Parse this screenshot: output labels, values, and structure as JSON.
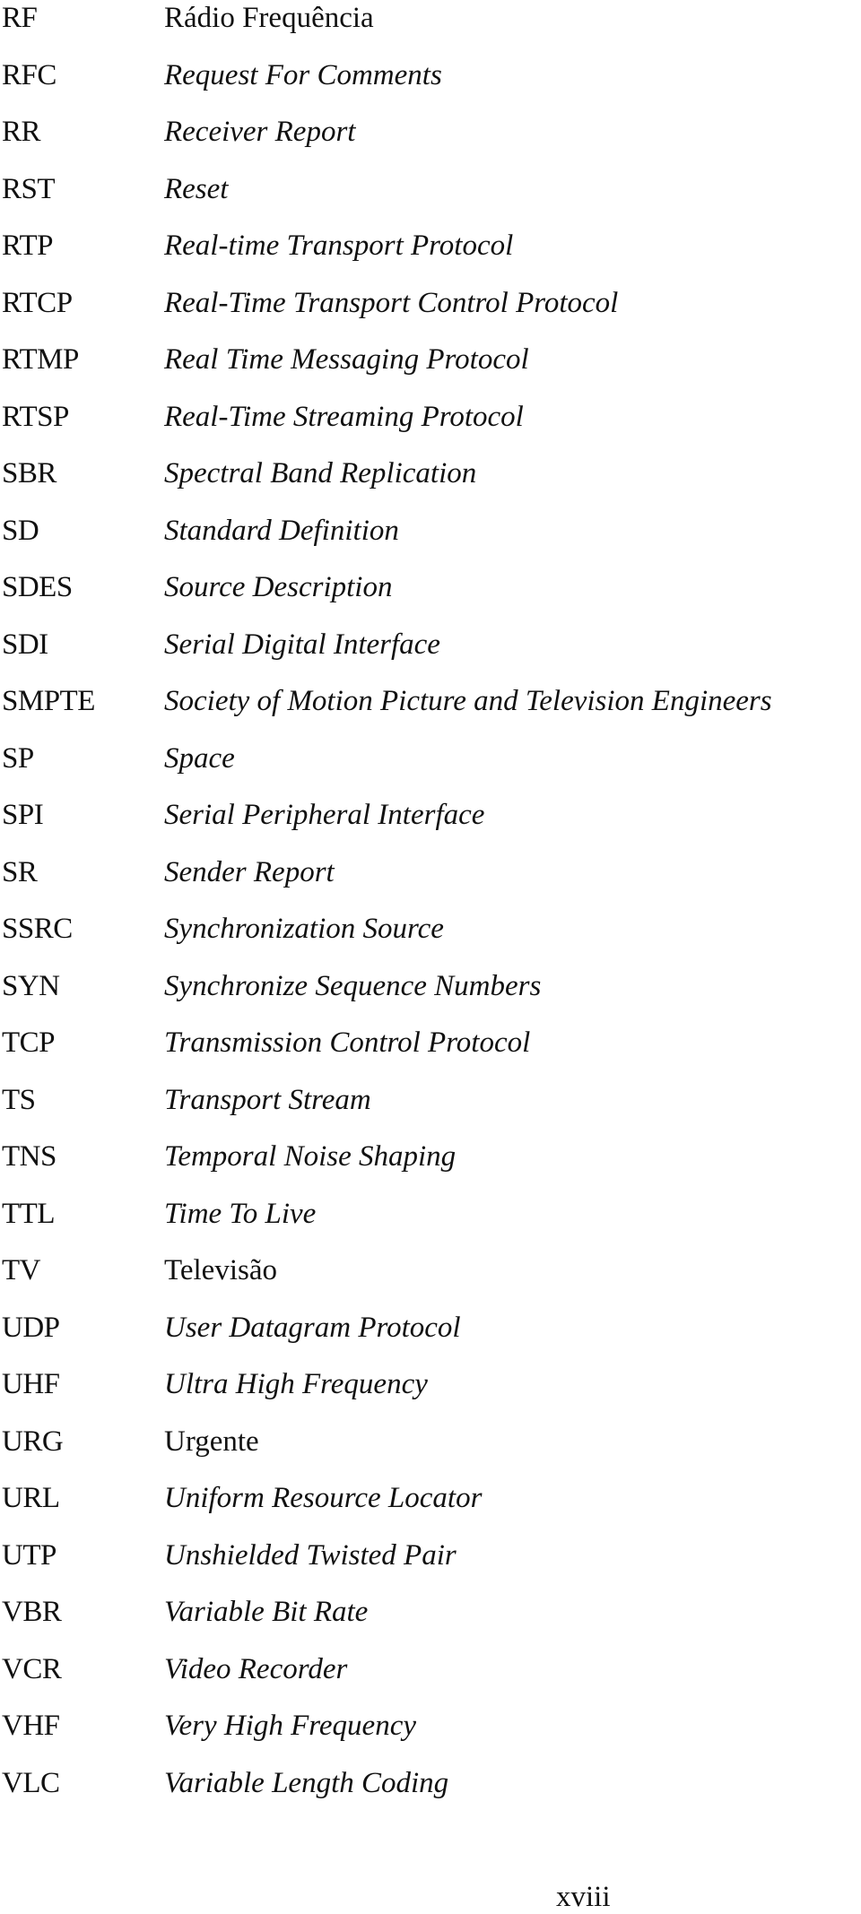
{
  "glossary": {
    "entries": [
      {
        "abbr": "RF",
        "definition": "Rádio Frequência",
        "italic": false
      },
      {
        "abbr": "RFC",
        "definition": "Request For Comments",
        "italic": true
      },
      {
        "abbr": "RR",
        "definition": "Receiver Report",
        "italic": true
      },
      {
        "abbr": "RST",
        "definition": "Reset",
        "italic": true
      },
      {
        "abbr": "RTP",
        "definition": "Real-time Transport Protocol",
        "italic": true
      },
      {
        "abbr": "RTCP",
        "definition": "Real-Time Transport Control Protocol",
        "italic": true
      },
      {
        "abbr": "RTMP",
        "definition": "Real Time Messaging Protocol",
        "italic": true
      },
      {
        "abbr": "RTSP",
        "definition": "Real-Time Streaming Protocol",
        "italic": true
      },
      {
        "abbr": "SBR",
        "definition": "Spectral Band Replication",
        "italic": true
      },
      {
        "abbr": "SD",
        "definition": "Standard Definition",
        "italic": true
      },
      {
        "abbr": "SDES",
        "definition": "Source Description",
        "italic": true
      },
      {
        "abbr": "SDI",
        "definition": "Serial Digital Interface",
        "italic": true
      },
      {
        "abbr": "SMPTE",
        "definition": "Society of Motion Picture and Television Engineers",
        "italic": true
      },
      {
        "abbr": "SP",
        "definition": "Space",
        "italic": true
      },
      {
        "abbr": "SPI",
        "definition": "Serial Peripheral Interface",
        "italic": true
      },
      {
        "abbr": "SR",
        "definition": "Sender Report",
        "italic": true
      },
      {
        "abbr": "SSRC",
        "definition": "Synchronization Source",
        "italic": true
      },
      {
        "abbr": "SYN",
        "definition": "Synchronize Sequence Numbers",
        "italic": true
      },
      {
        "abbr": "TCP",
        "definition": "Transmission Control Protocol",
        "italic": true
      },
      {
        "abbr": "TS",
        "definition": "Transport Stream",
        "italic": true
      },
      {
        "abbr": "TNS",
        "definition": "Temporal Noise Shaping",
        "italic": true
      },
      {
        "abbr": "TTL",
        "definition": "Time To Live",
        "italic": true
      },
      {
        "abbr": "TV",
        "definition": "Televisão",
        "italic": false
      },
      {
        "abbr": "UDP",
        "definition": "User Datagram Protocol",
        "italic": true
      },
      {
        "abbr": "UHF",
        "definition": "Ultra High Frequency",
        "italic": true
      },
      {
        "abbr": "URG",
        "definition": "Urgente",
        "italic": false
      },
      {
        "abbr": "URL",
        "definition": "Uniform Resource Locator",
        "italic": true
      },
      {
        "abbr": "UTP",
        "definition": "Unshielded Twisted Pair",
        "italic": true
      },
      {
        "abbr": "VBR",
        "definition": "Variable Bit Rate",
        "italic": true
      },
      {
        "abbr": "VCR",
        "definition": "Video Recorder",
        "italic": true
      },
      {
        "abbr": "VHF",
        "definition": "Very High Frequency",
        "italic": true
      },
      {
        "abbr": "VLC",
        "definition": "Variable Length Coding",
        "italic": true
      }
    ]
  },
  "footer": {
    "page_number": "xviii"
  }
}
